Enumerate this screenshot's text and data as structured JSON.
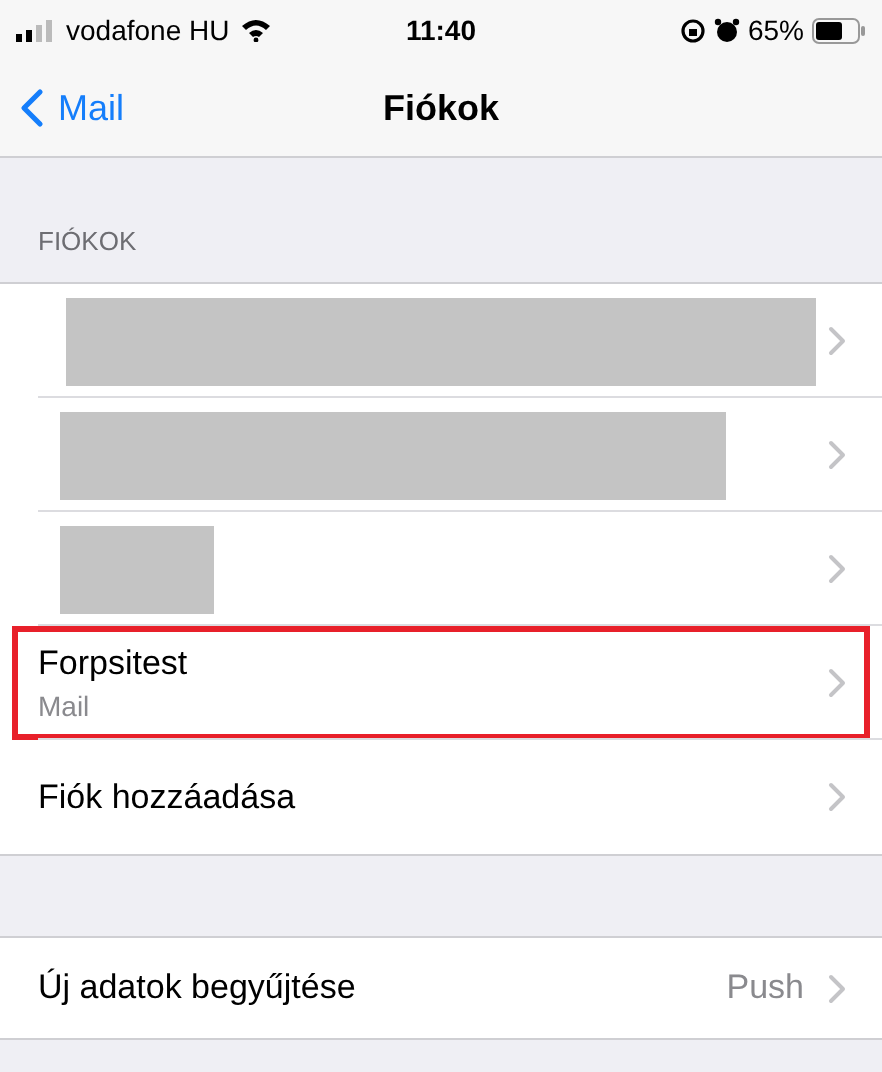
{
  "status_bar": {
    "carrier": "vodafone HU",
    "time": "11:40",
    "battery": "65%"
  },
  "nav": {
    "back": "Mail",
    "title": "Fiókok"
  },
  "section_header": "FIÓKOK",
  "accounts": [
    {
      "kind": "redacted",
      "highlighted": false
    },
    {
      "kind": "redacted",
      "highlighted": false
    },
    {
      "kind": "redacted",
      "highlighted": false
    },
    {
      "kind": "account",
      "title": "Forpsitest",
      "subtitle": "Mail",
      "highlighted": true
    },
    {
      "kind": "action",
      "title": "Fiók hozzáadása",
      "highlighted": false
    }
  ],
  "settings": [
    {
      "title": "Új adatok begyűjtése",
      "value": "Push"
    }
  ]
}
